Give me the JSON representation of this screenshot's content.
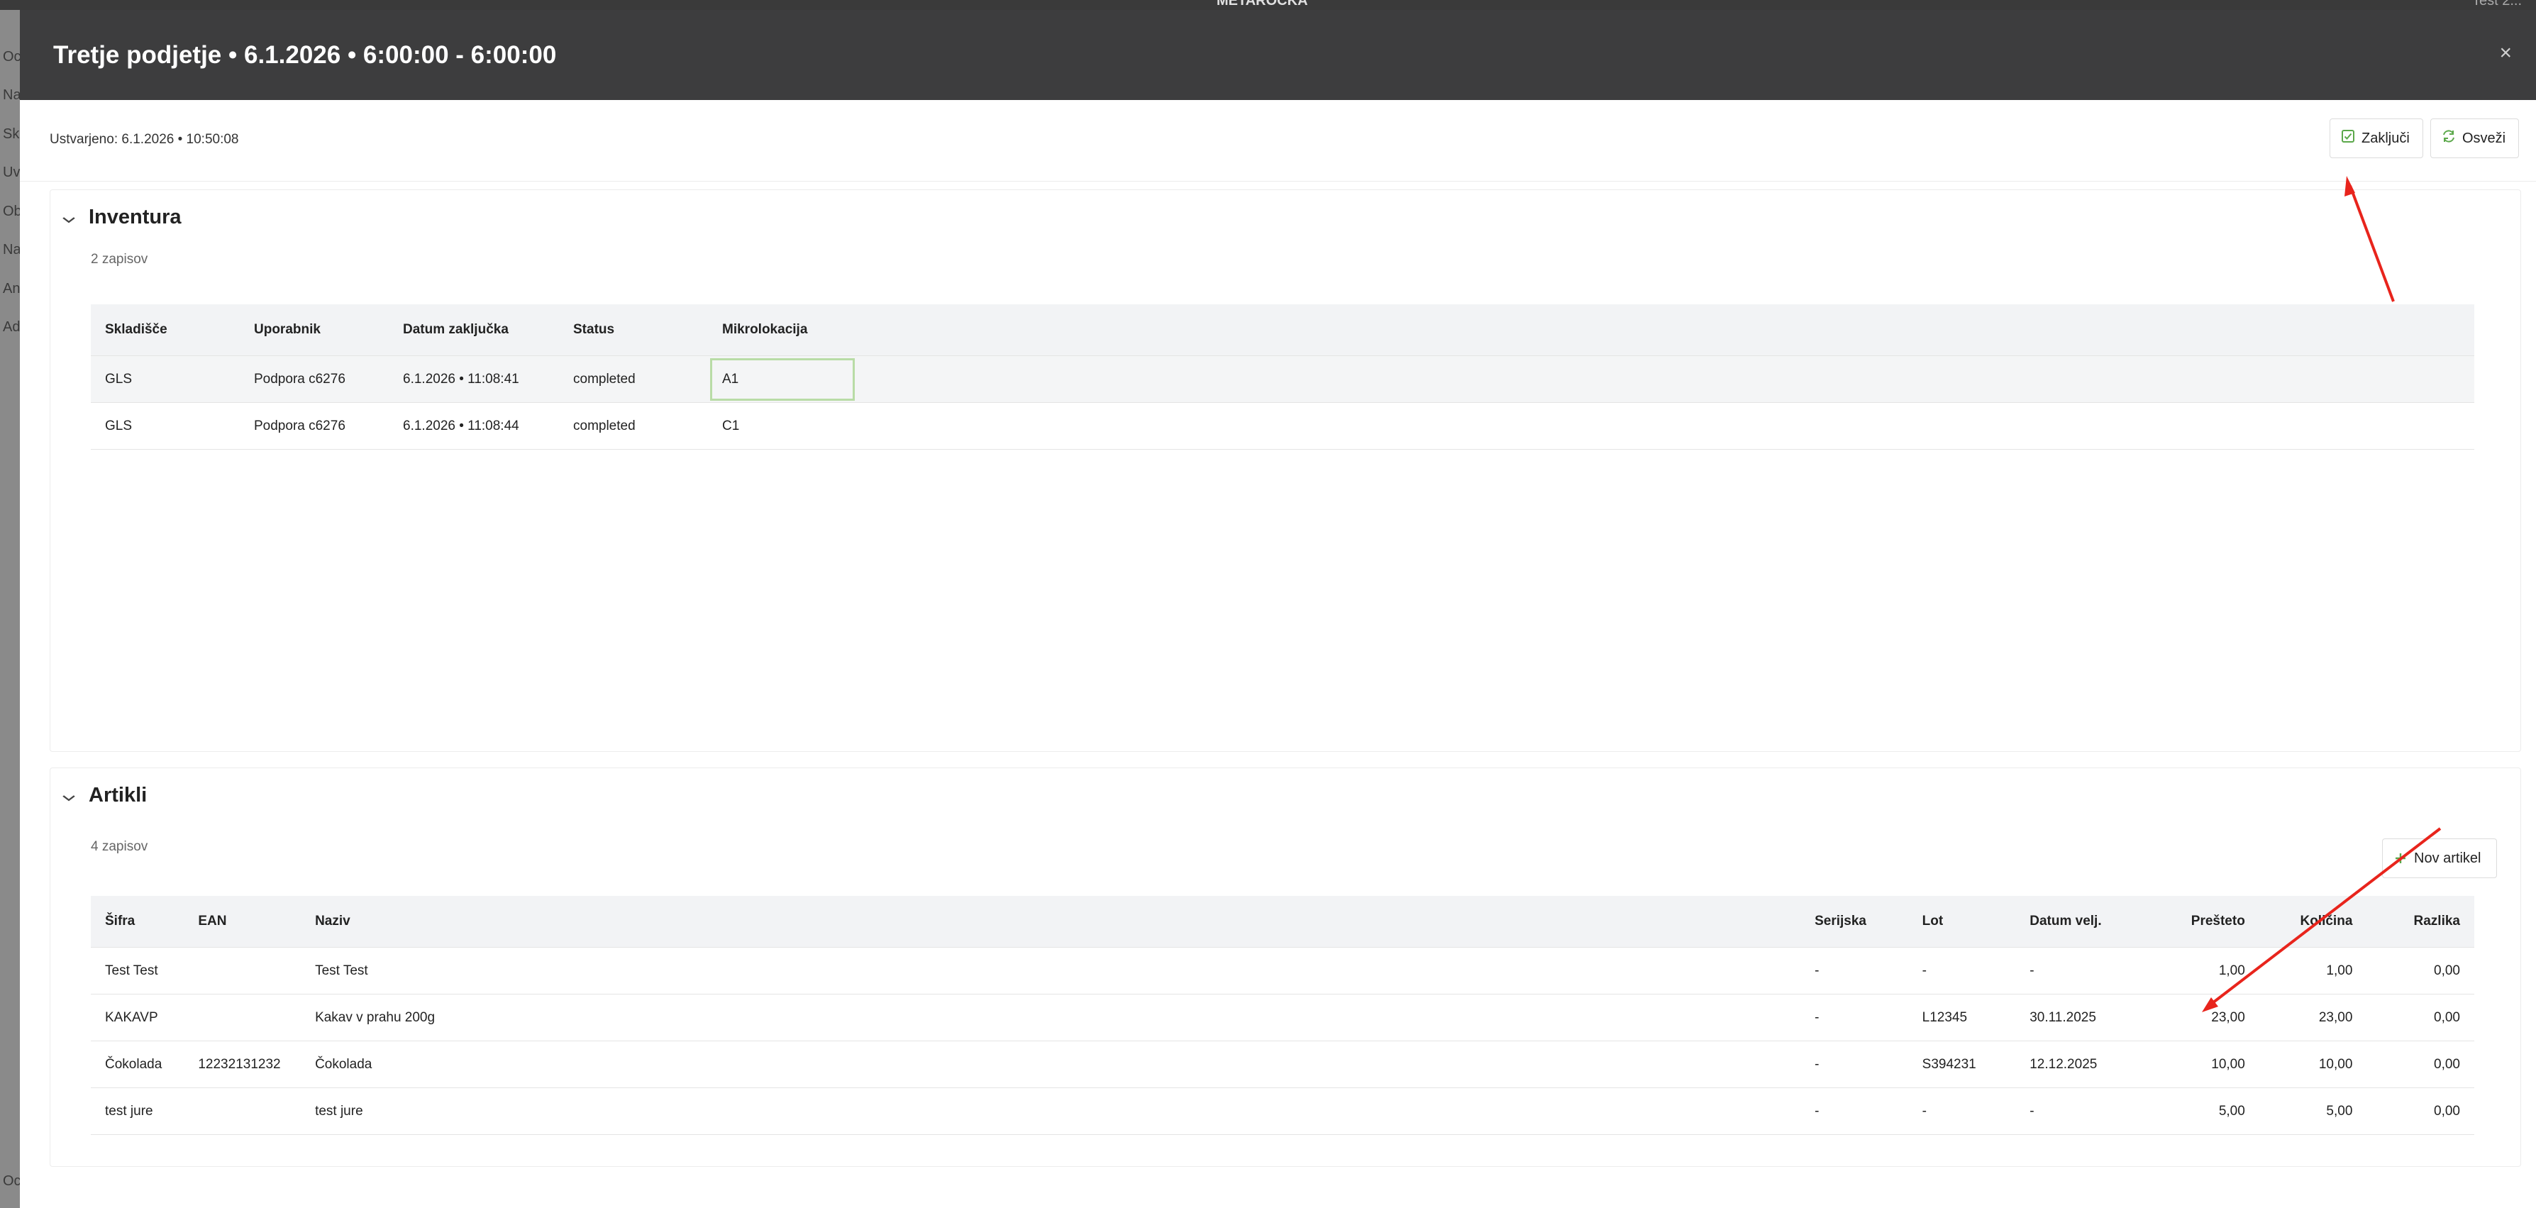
{
  "modal": {
    "title": "Tretje podjetje • 6.1.2026 • 6:00:00 - 6:00:00",
    "close_glyph": "×",
    "created": "Ustvarjeno: 6.1.2026 • 10:50:08",
    "buttons": {
      "finalize": "Zaključi",
      "refresh": "Osveži"
    }
  },
  "inventory": {
    "title": "Inventura",
    "count": "2 zapisov",
    "columns": [
      "Skladišče",
      "Uporabnik",
      "Datum zaključka",
      "Status",
      "Mikrolokacija"
    ],
    "rows": [
      [
        "GLS",
        "Podpora c6276",
        "6.1.2026 • 11:08:41",
        "completed",
        "A1"
      ],
      [
        "GLS",
        "Podpora c6276",
        "6.1.2026 • 11:08:44",
        "completed",
        "C1"
      ]
    ]
  },
  "articles": {
    "title": "Artikli",
    "count": "4 zapisov",
    "new_button": "Nov artikel",
    "columns": [
      "Šifra",
      "EAN",
      "Naziv",
      "Serijska",
      "Lot",
      "Datum velj.",
      "Prešteto",
      "Količina",
      "Razlika"
    ],
    "rows": [
      [
        "Test Test",
        "",
        "Test Test",
        "-",
        "-",
        "-",
        "1,00",
        "1,00",
        "0,00"
      ],
      [
        "KAKAVP",
        "",
        "Kakav v prahu 200g",
        "-",
        "L12345",
        "30.11.2025",
        "23,00",
        "23,00",
        "0,00"
      ],
      [
        "Čokolada",
        "12232131232",
        "Čokolada",
        "-",
        "S394231",
        "12.12.2025",
        "10,00",
        "10,00",
        "0,00"
      ],
      [
        "test jure",
        "",
        "test jure",
        "-",
        "-",
        "-",
        "5,00",
        "5,00",
        "0,00"
      ]
    ]
  },
  "background": {
    "logo": "METAROCKA",
    "user": "Test 2...",
    "sidebar_letters": [
      "Oc",
      "Na",
      "Sk",
      "Uv",
      "Ob",
      "Na",
      "An",
      "Ad",
      "Oc"
    ]
  },
  "colors": {
    "header_bg": "#3d3d3e",
    "accent_green": "#5ba84a",
    "annotation_red": "#e8241c"
  },
  "icons": {
    "finalize": "checkbox-check-icon",
    "refresh": "refresh-icon",
    "new": "plus-icon",
    "collapse": "chevron-down-icon"
  }
}
